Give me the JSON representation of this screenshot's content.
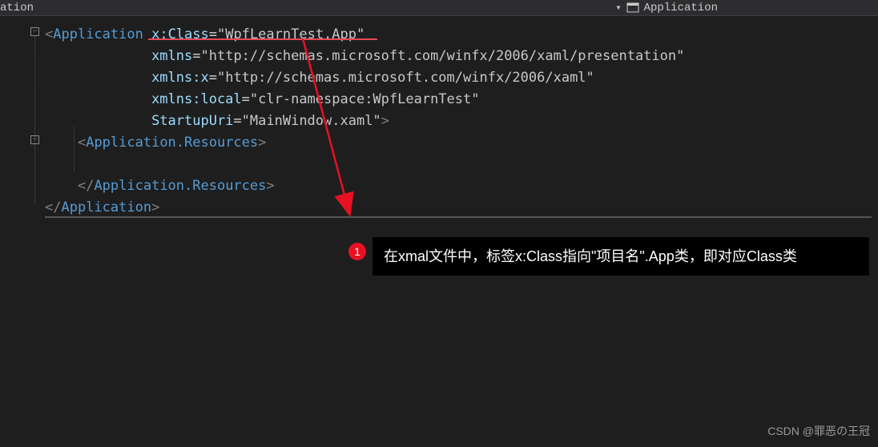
{
  "header": {
    "left_tab": "ation",
    "right_label": "Application"
  },
  "code": {
    "line1_tag": "Application",
    "line1_attr": "x:Class",
    "line1_val": "\"WpfLearnTest.App\"",
    "line2_attr": "xmlns",
    "line2_val": "\"http://schemas.microsoft.com/winfx/2006/xaml/presentation\"",
    "line3_attr": "xmlns:x",
    "line3_val": "\"http://schemas.microsoft.com/winfx/2006/xaml\"",
    "line4_attr": "xmlns:local",
    "line4_val": "\"clr-namespace:WpfLearnTest\"",
    "line5_attr": "StartupUri",
    "line5_val": "\"MainWindow.xaml\"",
    "line6_tag": "Application.Resources",
    "line8_tag": "Application.Resources",
    "line9_tag": "Application"
  },
  "callout": {
    "badge": "1",
    "text": "在xmal文件中，标签x:Class指向\"项目名\".App类，即对应Class类"
  },
  "watermark": "CSDN @罪恶の王冠",
  "fold_minus": "−"
}
